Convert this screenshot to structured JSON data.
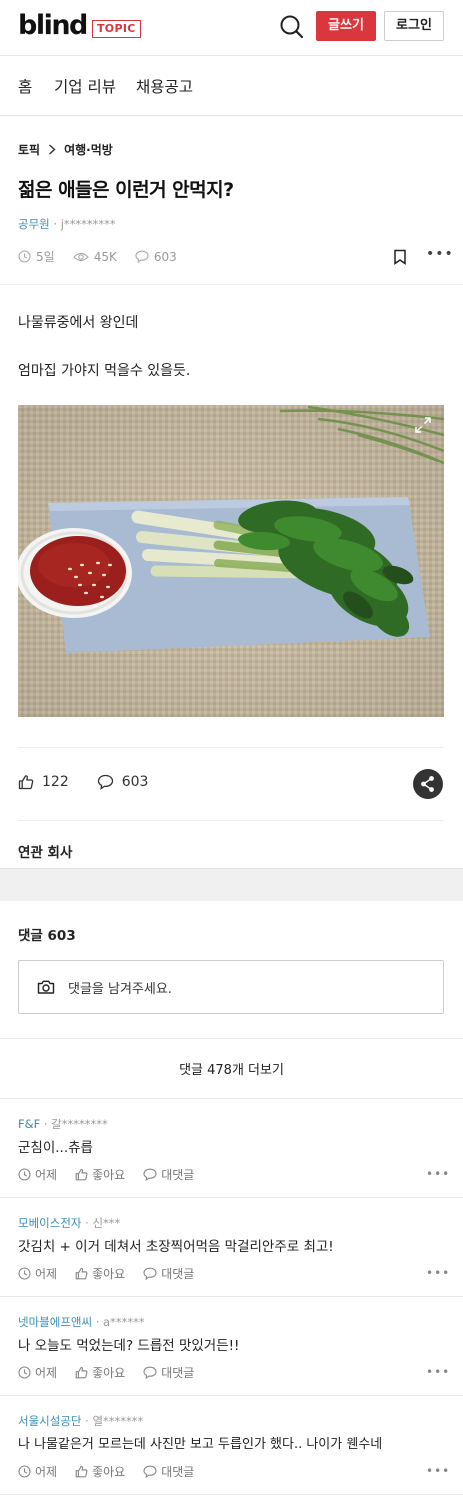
{
  "header": {
    "logo": "blind",
    "badge": "TOPIC",
    "write_label": "글쓰기",
    "login_label": "로그인"
  },
  "nav": {
    "items": [
      {
        "label": "홈"
      },
      {
        "label": "기업 리뷰"
      },
      {
        "label": "채용공고"
      }
    ]
  },
  "post": {
    "breadcrumb": [
      "토픽",
      "여행·먹방"
    ],
    "title": "젊은 애들은 이런거 안먹지?",
    "author_company": "공무원",
    "author_id": "j*********",
    "time": "5일",
    "views": "45K",
    "comments": "603",
    "body": [
      "나물류중에서 왕인데",
      "엄마집 가야지 먹을수 있을듯."
    ],
    "likes": "122",
    "comment_count": "603"
  },
  "related": {
    "title": "연관 회사"
  },
  "comments": {
    "title": "댓글 603",
    "placeholder": "댓글을 남겨주세요.",
    "more_label": "댓글 478개 더보기",
    "action_labels": {
      "time": "어제",
      "like": "좋아요",
      "reply": "대댓글"
    },
    "items": [
      {
        "company": "F&F",
        "user": "갈********",
        "text": "군침이...츄릅"
      },
      {
        "company": "모베이스전자",
        "user": "신***",
        "text": "갓김치 + 이거 데쳐서 초장찍어먹음 막걸리안주로 최고!"
      },
      {
        "company": "넷마블에프앤씨",
        "user": "a******",
        "text": "나 오늘도 먹었는데? 드릅전 맛있거든!!"
      },
      {
        "company": "서울시설공단",
        "user": "열*******",
        "text": "나 나물같은거 모르는데 사진만 보고 두릅인가 했다.. 나이가 웬수네"
      }
    ]
  },
  "colors": {
    "accent": "#d9363e",
    "company_link": "#3a8fb7",
    "band": "#f0f0f0"
  },
  "icons": [
    "search-icon",
    "chevron-right-icon",
    "clock-icon",
    "eye-icon",
    "comment-icon",
    "bookmark-icon",
    "more-icon",
    "expand-icon",
    "thumbs-up-icon",
    "share-icon",
    "camera-icon"
  ]
}
